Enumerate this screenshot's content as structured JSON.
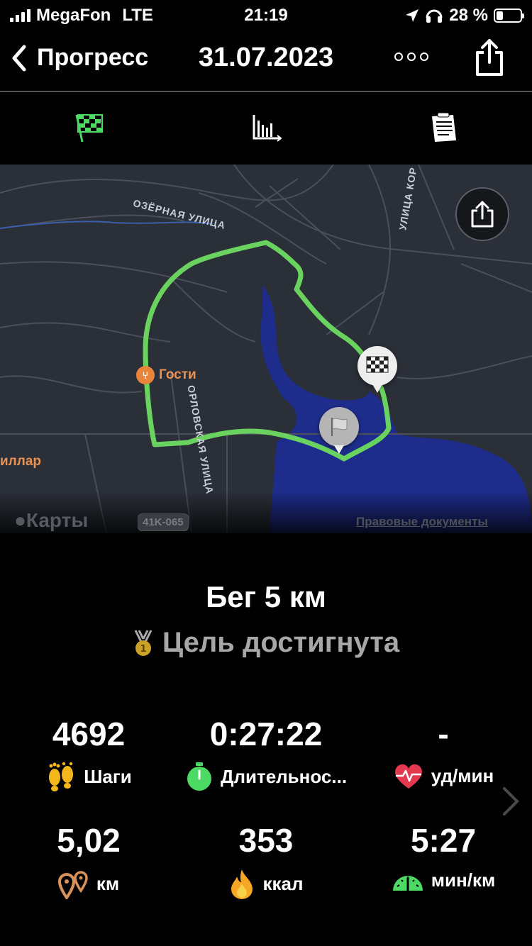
{
  "status_bar": {
    "carrier": "MegaFon",
    "network": "LTE",
    "time": "21:19",
    "battery_percent": "28 %"
  },
  "nav": {
    "back_label": "Прогресс",
    "date": "31.07.2023"
  },
  "tabs": [
    {
      "icon": "checkered-flag-icon",
      "active": true
    },
    {
      "icon": "bar-chart-icon",
      "active": false
    },
    {
      "icon": "notes-icon",
      "active": false
    }
  ],
  "map": {
    "streets": {
      "ozernaya": "ОЗЁРНАЯ УЛИЦА",
      "orlovskaya": "ОРЛОВСКАЯ УЛИЦА",
      "korolyova": "УЛИЦА КОР"
    },
    "poi": {
      "gosti": "Гости",
      "pillar": "иллар"
    },
    "maps_logo": "Карты",
    "road_badge": "41K-065",
    "legal": "Правовые документы",
    "route_color": "#6ad35f",
    "water_color": "#1e2d8c"
  },
  "workout": {
    "title": "Бег 5 км",
    "goal": "Цель достигнута"
  },
  "stats": {
    "steps": {
      "value": "4692",
      "label": "Шаги"
    },
    "duration": {
      "value": "0:27:22",
      "label": "Длительнос..."
    },
    "heart_rate": {
      "value": "-",
      "label": "уд/мин"
    },
    "distance": {
      "value": "5,02",
      "label": "км"
    },
    "calories": {
      "value": "353",
      "label": "ккал"
    },
    "pace": {
      "value": "5:27",
      "label": "мин/км"
    }
  },
  "colors": {
    "accent_green": "#4cd964",
    "flame": "#f5a623",
    "heart": "#e53950"
  }
}
